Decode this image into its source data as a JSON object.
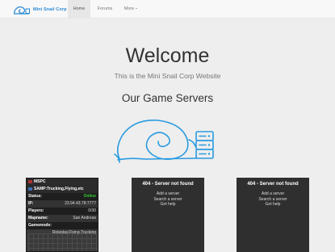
{
  "nav": {
    "brand": "Mini Snail Corp",
    "items": [
      {
        "label": "Home",
        "active": true
      },
      {
        "label": "Forums",
        "active": false
      },
      {
        "label": "More",
        "active": false
      }
    ]
  },
  "hero": {
    "title": "Welcome",
    "subtitle": "This is the Mini Snail Corp Website"
  },
  "servers_heading": "Our Game Servers",
  "server_card": {
    "name": "MSPC",
    "description": "SAMP:Trucking,Flying,etc",
    "rows": [
      {
        "label": "Status:",
        "value": "Online"
      },
      {
        "label": "IP:",
        "value": "23.94.43.78:7777"
      },
      {
        "label": "Players:",
        "value": "0/30"
      },
      {
        "label": "Mapname:",
        "value": "San Andreas"
      },
      {
        "label": "Gamemode:",
        "value": "Roleplay,Flying,Trucking"
      }
    ]
  },
  "not_found_cards": [
    {
      "title": "404 - Server not found",
      "links": [
        "Add a server",
        "Search a server",
        "Get help"
      ]
    },
    {
      "title": "404 - Server not found",
      "links": [
        "Add a server",
        "Search a server",
        "Get help"
      ]
    }
  ],
  "colors": {
    "brand": "#2a8ad6",
    "online": "#33cc33",
    "card_bg": "#2f2f2f"
  }
}
